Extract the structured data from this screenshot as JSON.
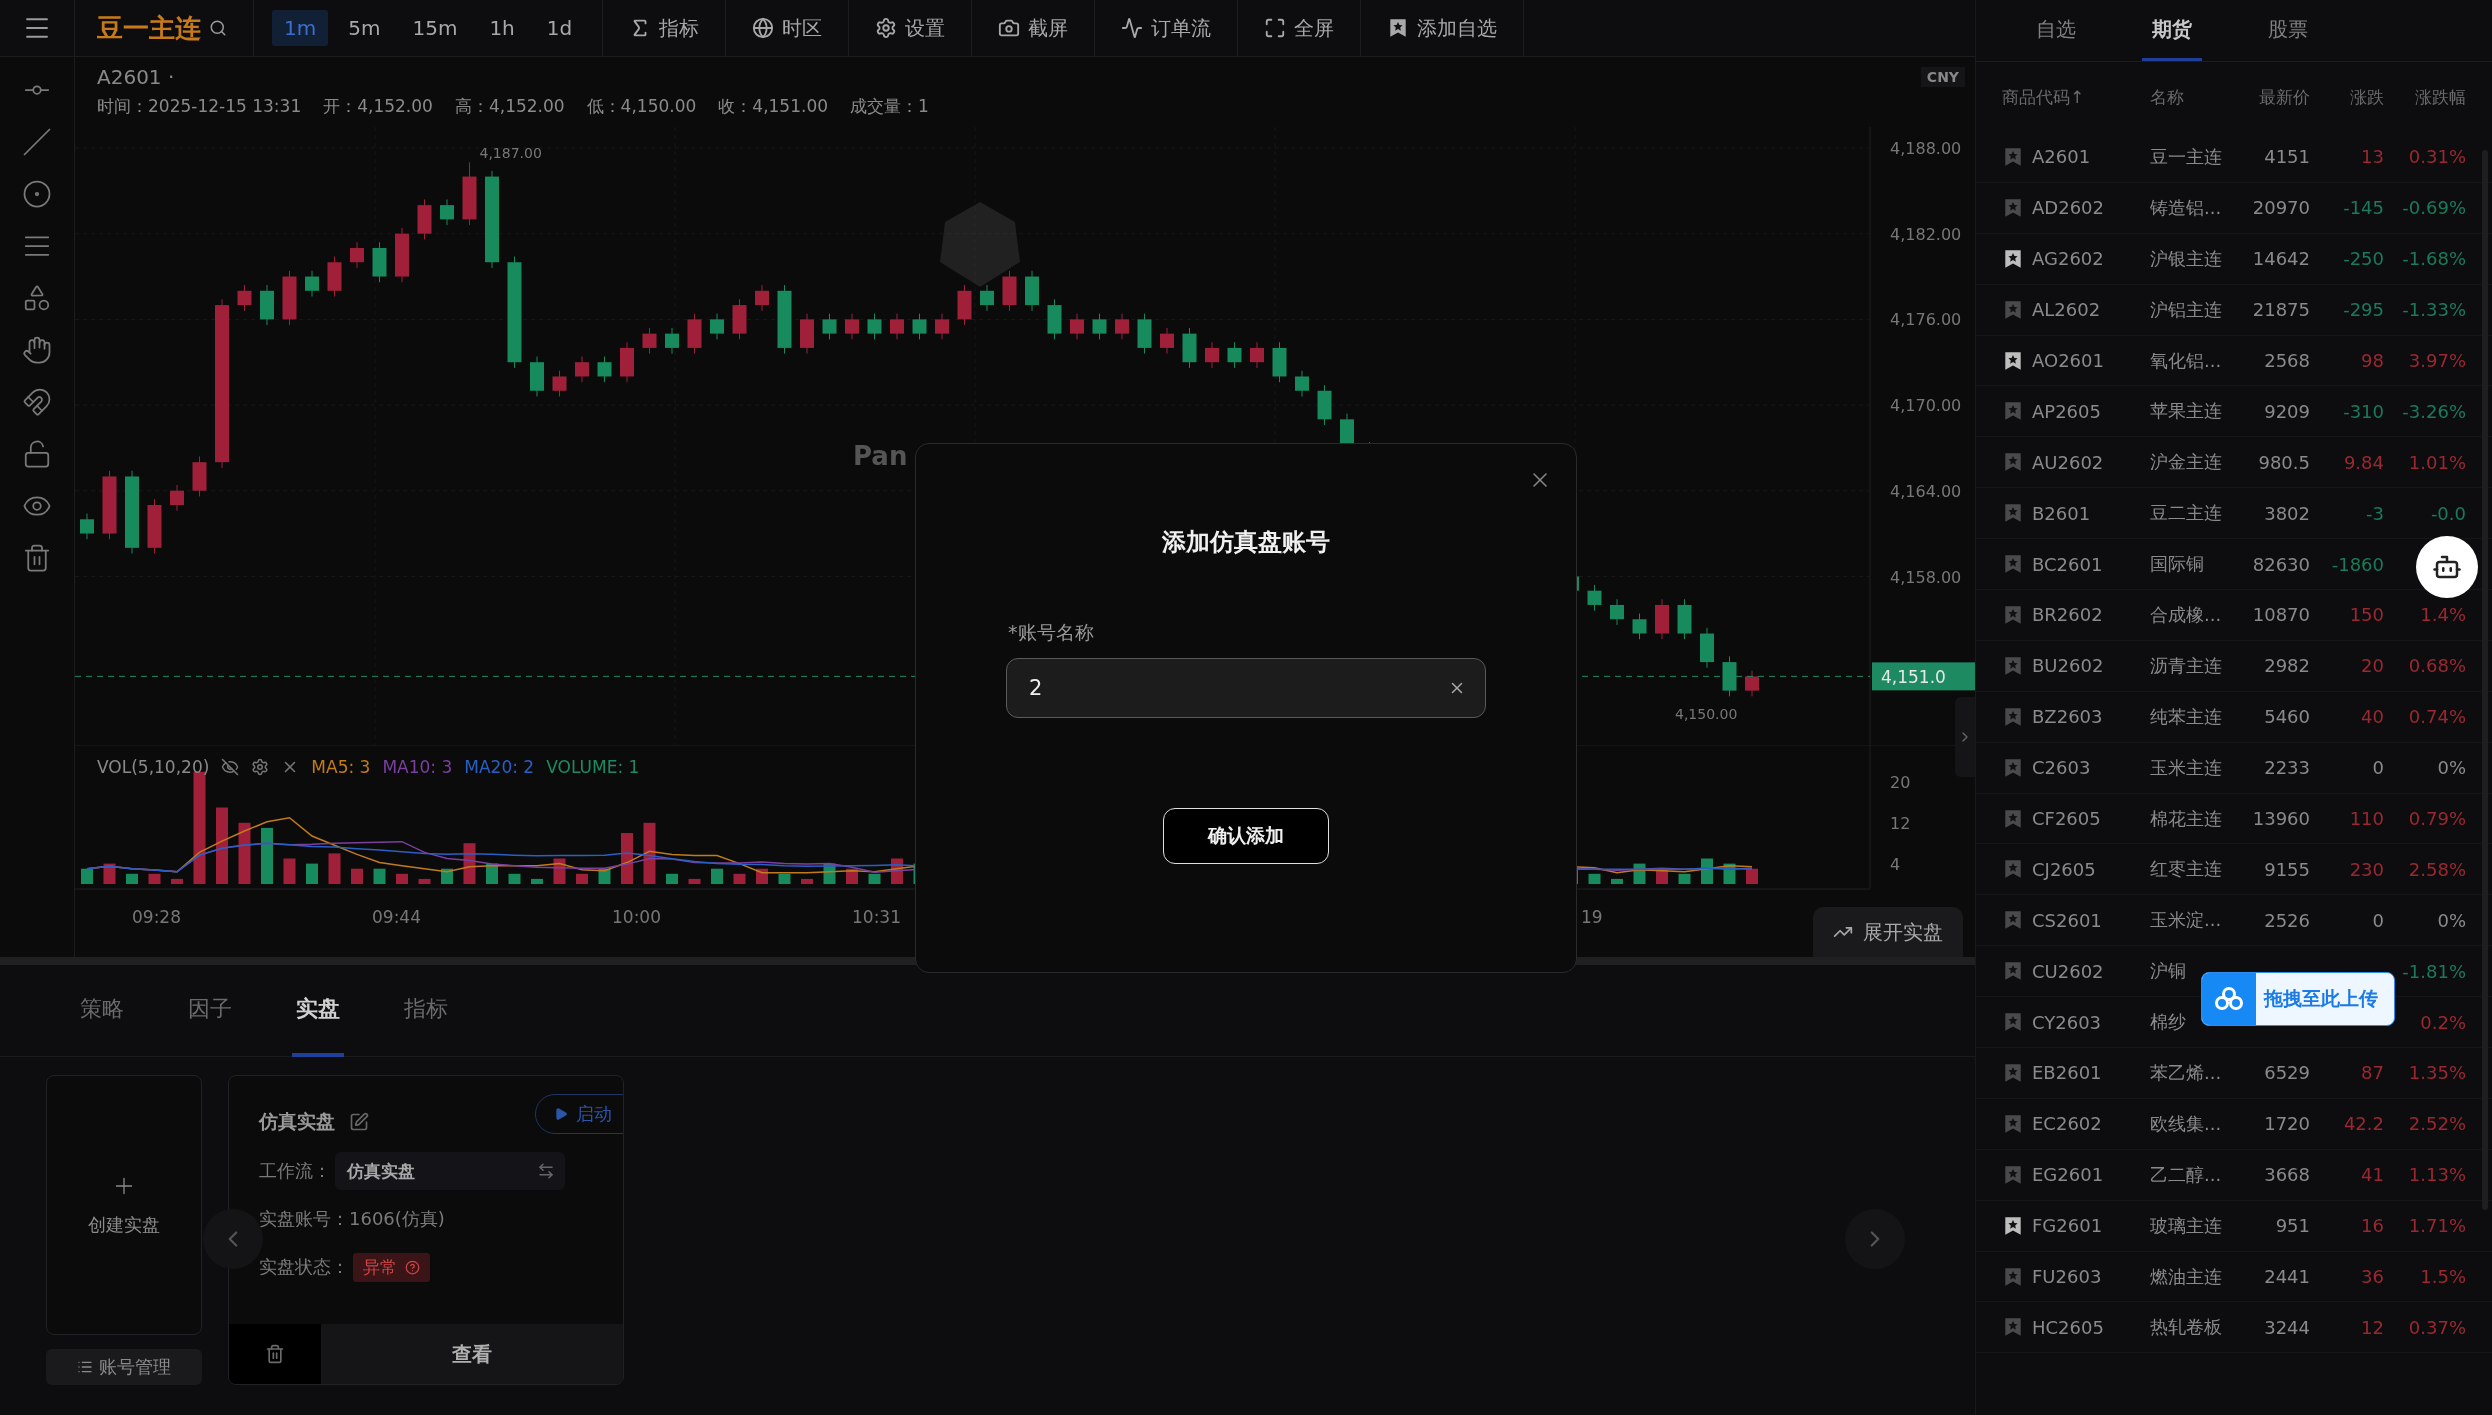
{
  "top_bar": {
    "symbol": "豆一主连",
    "intervals": [
      {
        "label": "1m",
        "selected": true
      },
      {
        "label": "5m",
        "selected": false
      },
      {
        "label": "15m",
        "selected": false
      },
      {
        "label": "1h",
        "selected": false
      },
      {
        "label": "1d",
        "selected": false
      }
    ],
    "tools": [
      {
        "kind": "indicator",
        "label": "指标"
      },
      {
        "kind": "timezone",
        "label": "时区"
      },
      {
        "kind": "settings",
        "label": "设置"
      },
      {
        "kind": "screenshot",
        "label": "截屏"
      },
      {
        "kind": "orderflow",
        "label": "订单流"
      },
      {
        "kind": "fullscreen",
        "label": "全屏"
      },
      {
        "kind": "watch",
        "label": "添加自选"
      }
    ]
  },
  "drawing_tools": [
    {
      "kind": "ray"
    },
    {
      "kind": "trend"
    },
    {
      "kind": "circle"
    },
    {
      "kind": "lines"
    },
    {
      "kind": "shape"
    },
    {
      "kind": "hand"
    },
    {
      "kind": "magnet"
    },
    {
      "kind": "lock"
    },
    {
      "kind": "eye"
    },
    {
      "kind": "trash"
    }
  ],
  "chart": {
    "symbol_line": "A2601 ·",
    "info": [
      "时间：2025-12-15 13:31",
      "开：4,152.00",
      "高：4,152.00",
      "低：4,150.00",
      "收：4,151.00",
      "成交量：1"
    ],
    "currency": "CNY",
    "price_axis": [
      "4,188.00",
      "4,182.00",
      "4,176.00",
      "4,170.00",
      "4,164.00",
      "4,158.00"
    ],
    "last_price": "4,151.0",
    "high_label": "4,187.00",
    "low_label": "4,150.00",
    "watermark": "Pan",
    "volume_legend": {
      "title": "VOL(5,10,20)",
      "series": [
        {
          "label": "MA5: 3",
          "color": "#c27b1a"
        },
        {
          "label": "MA10: 3",
          "color": "#7b3fa0"
        },
        {
          "label": "MA20: 2",
          "color": "#2a5fc4"
        },
        {
          "label": "VOLUME: 1",
          "color": "#1e8a62"
        }
      ]
    },
    "volume_axis": [
      "20",
      "12",
      "4"
    ],
    "time_axis": [
      "09:28",
      "09:44",
      "10:00",
      "10:31",
      "19"
    ],
    "expand_button": "展开实盘"
  },
  "bottom_panel": {
    "tabs": [
      {
        "label": "策略",
        "selected": false
      },
      {
        "label": "因子",
        "selected": false
      },
      {
        "label": "实盘",
        "selected": true
      },
      {
        "label": "指标",
        "selected": false
      }
    ],
    "create_label": "创建实盘",
    "account_button": "账号管理",
    "strategy_card": {
      "title": "仿真实盘",
      "start_button": "启动",
      "workflow_label": "工作流：",
      "workflow_value": "仿真实盘",
      "account_text": "实盘账号：1606(仿真)",
      "status_label": "实盘状态：",
      "status": "异常",
      "view_button": "查看"
    }
  },
  "watchlist": {
    "tabs": [
      {
        "label": "自选",
        "selected": false
      },
      {
        "label": "期货",
        "selected": true
      },
      {
        "label": "股票",
        "selected": false
      }
    ],
    "columns": [
      "商品代码↑",
      "名称",
      "最新价",
      "涨跌",
      "涨跌幅"
    ],
    "rows": [
      {
        "code": "A2601",
        "name": "豆一主连",
        "price": "4151",
        "change": "13",
        "pct": "0.31%",
        "color": "#9a2830",
        "starred": false
      },
      {
        "code": "AD2602",
        "name": "铸造铝...",
        "price": "20970",
        "change": "-145",
        "pct": "-0.69%",
        "color": "#1b7a58",
        "starred": false
      },
      {
        "code": "AG2602",
        "name": "沪银主连",
        "price": "14642",
        "change": "-250",
        "pct": "-1.68%",
        "color": "#1b7a58",
        "starred": true
      },
      {
        "code": "AL2602",
        "name": "沪铝主连",
        "price": "21875",
        "change": "-295",
        "pct": "-1.33%",
        "color": "#1b7a58",
        "starred": false
      },
      {
        "code": "AO2601",
        "name": "氧化铝...",
        "price": "2568",
        "change": "98",
        "pct": "3.97%",
        "color": "#9a2830",
        "starred": true
      },
      {
        "code": "AP2605",
        "name": "苹果主连",
        "price": "9209",
        "change": "-310",
        "pct": "-3.26%",
        "color": "#1b7a58",
        "starred": false
      },
      {
        "code": "AU2602",
        "name": "沪金主连",
        "price": "980.5",
        "change": "9.84",
        "pct": "1.01%",
        "color": "#9a2830",
        "starred": false
      },
      {
        "code": "B2601",
        "name": "豆二主连",
        "price": "3802",
        "change": "-3",
        "pct": "-0.0",
        "color": "#1b7a58",
        "starred": false
      },
      {
        "code": "BC2601",
        "name": "国际铜",
        "price": "82630",
        "change": "-1860",
        "color": "#1b7a58",
        "starred": false
      },
      {
        "code": "BR2602",
        "name": "合成橡...",
        "price": "10870",
        "change": "150",
        "pct": "1.4%",
        "color": "#9a2830",
        "starred": false
      },
      {
        "code": "BU2602",
        "name": "沥青主连",
        "price": "2982",
        "change": "20",
        "pct": "0.68%",
        "color": "#9a2830",
        "starred": false
      },
      {
        "code": "BZ2603",
        "name": "纯苯主连",
        "price": "5460",
        "change": "40",
        "pct": "0.74%",
        "color": "#9a2830",
        "starred": false
      },
      {
        "code": "C2603",
        "name": "玉米主连",
        "price": "2233",
        "change": "0",
        "pct": "0%",
        "color": "#8a8a8a",
        "starred": false
      },
      {
        "code": "CF2605",
        "name": "棉花主连",
        "price": "13960",
        "change": "110",
        "pct": "0.79%",
        "color": "#9a2830",
        "starred": false
      },
      {
        "code": "CJ2605",
        "name": "红枣主连",
        "price": "9155",
        "change": "230",
        "pct": "2.58%",
        "color": "#9a2830",
        "starred": false
      },
      {
        "code": "CS2601",
        "name": "玉米淀...",
        "price": "2526",
        "change": "0",
        "pct": "0%",
        "color": "#8a8a8a",
        "starred": false
      },
      {
        "code": "CU2602",
        "name": "沪铜",
        "pct": "-1.81%",
        "color": "#1b7a58",
        "starred": false
      },
      {
        "code": "CY2603",
        "name": "棉纱",
        "pct": "0.2%",
        "color": "#9a2830",
        "starred": false
      },
      {
        "code": "EB2601",
        "name": "苯乙烯...",
        "price": "6529",
        "change": "87",
        "pct": "1.35%",
        "color": "#9a2830",
        "starred": false
      },
      {
        "code": "EC2602",
        "name": "欧线集...",
        "price": "1720",
        "change": "42.2",
        "pct": "2.52%",
        "color": "#9a2830",
        "starred": false
      },
      {
        "code": "EG2601",
        "name": "乙二醇...",
        "price": "3668",
        "change": "41",
        "pct": "1.13%",
        "color": "#9a2830",
        "starred": false
      },
      {
        "code": "FG2601",
        "name": "玻璃主连",
        "price": "951",
        "change": "16",
        "pct": "1.71%",
        "color": "#9a2830",
        "starred": true
      },
      {
        "code": "FU2603",
        "name": "燃油主连",
        "price": "2441",
        "change": "36",
        "pct": "1.5%",
        "color": "#9a2830",
        "starred": false
      },
      {
        "code": "HC2605",
        "name": "热轧卷板",
        "price": "3244",
        "change": "12",
        "pct": "0.37%",
        "color": "#9a2830",
        "starred": false
      }
    ]
  },
  "upload_badge": "拖拽至此上传",
  "dialog": {
    "title": "添加仿真盘账号",
    "field_label": "*账号名称",
    "field_value": "2",
    "confirm_button": "确认添加"
  }
}
